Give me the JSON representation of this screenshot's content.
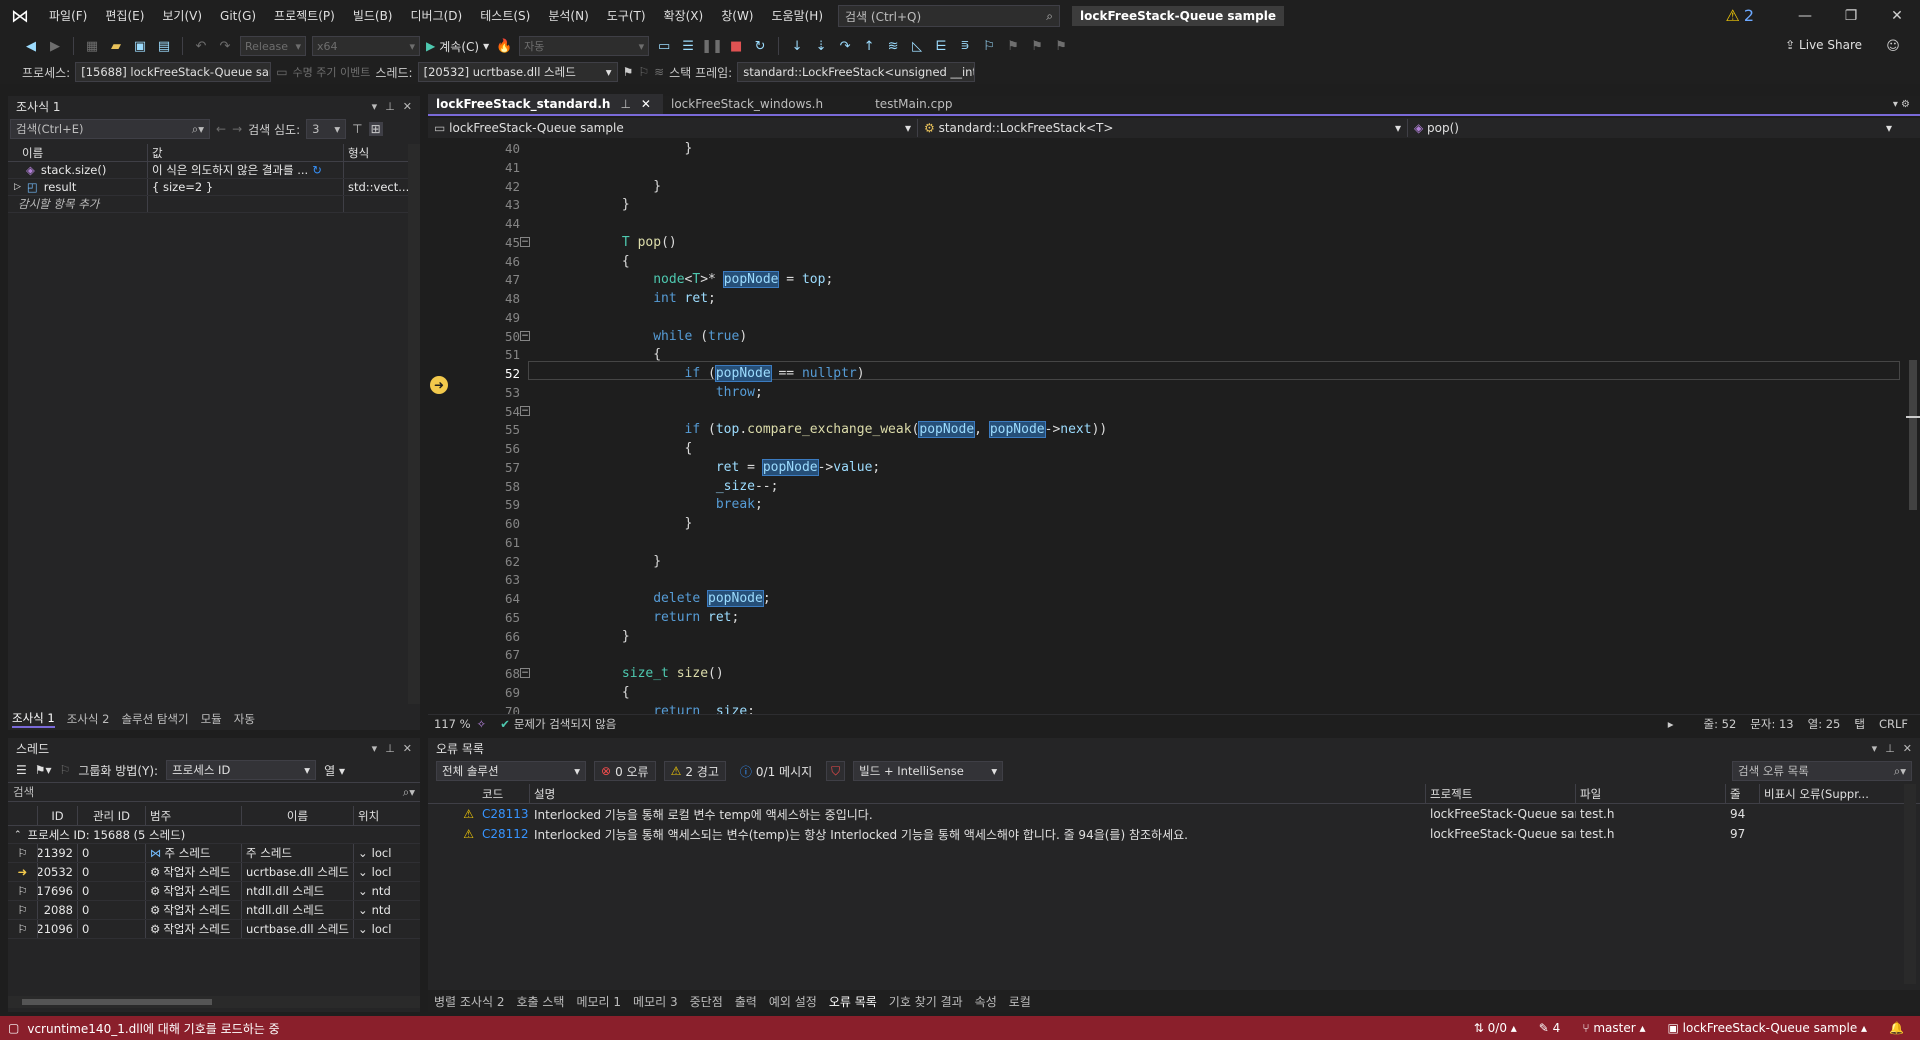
{
  "menu": {
    "items": [
      "파일(F)",
      "편집(E)",
      "보기(V)",
      "Git(G)",
      "프로젝트(P)",
      "빌드(B)",
      "디버그(D)",
      "테스트(S)",
      "분석(N)",
      "도구(T)",
      "확장(X)",
      "창(W)",
      "도움말(H)"
    ],
    "search_placeholder": "검색 (Ctrl+Q)",
    "solution_title": "lockFreeStack-Queue sample",
    "warning_count": "2"
  },
  "toolbar": {
    "config": "Release",
    "platform": "x64",
    "continue_label": "계속(C)",
    "auto_label": "자동",
    "live_share": "Live Share"
  },
  "debugbar": {
    "process_label": "프로세스:",
    "process_value": "[15688] lockFreeStack-Queue sar",
    "lifecycle_label": "수명 주기 이벤트",
    "thread_label": "스레드:",
    "thread_value": "[20532] ucrtbase.dll 스레드",
    "stackframe_label": "스택 프레임:",
    "stackframe_value": "standard::LockFreeStack<unsigned __int6"
  },
  "watch": {
    "title": "조사식 1",
    "search_placeholder": "검색(Ctrl+E)",
    "depth_label": "검색 심도:",
    "depth_value": "3",
    "columns": [
      "이름",
      "값",
      "형식"
    ],
    "rows": [
      {
        "name": "stack.size()",
        "value": "이 식은 의도하지 않은 결과를 ...",
        "type": ""
      },
      {
        "name": "result",
        "value": "{ size=2 }",
        "type": "std::vect..."
      }
    ],
    "add_item": "감시할 항목 추가",
    "tabs": [
      "조사식 1",
      "조사식 2",
      "솔루션 탐색기",
      "모듈",
      "자동"
    ]
  },
  "editor": {
    "tabs": [
      {
        "label": "lockFreeStack_standard.h",
        "active": true
      },
      {
        "label": "lockFreeStack_windows.h",
        "active": false
      },
      {
        "label": "testMain.cpp",
        "active": false
      }
    ],
    "nav_project": "lockFreeStack-Queue sample",
    "nav_scope": "standard::LockFreeStack<T>",
    "nav_member": "pop()",
    "line_numbers": [
      "40",
      "41",
      "42",
      "43",
      "44",
      "45",
      "46",
      "47",
      "48",
      "49",
      "50",
      "51",
      "52",
      "53",
      "54",
      "55",
      "56",
      "57",
      "58",
      "59",
      "60",
      "61",
      "62",
      "63",
      "64",
      "65",
      "66",
      "67",
      "68",
      "69",
      "70"
    ],
    "zoom": "117 %",
    "no_issues": "문제가 검색되지 않음",
    "line": "줄: 52",
    "char": "문자: 13",
    "col": "열: 25",
    "tab": "탭",
    "eol": "CRLF"
  },
  "threads": {
    "title": "스레드",
    "group_label": "그룹화 방법(Y):",
    "group_value": "프로세스 ID",
    "columns_label": "열",
    "search_placeholder": "검색",
    "columns": [
      "ID",
      "관리 ID",
      "범주",
      "이름",
      "위치"
    ],
    "process_group": "프로세스 ID: 15688  (5 스레드)",
    "rows": [
      {
        "id": "21392",
        "managed": "0",
        "category": "주 스레드",
        "name": "주 스레드",
        "loc": "locl"
      },
      {
        "id": "20532",
        "managed": "0",
        "category": "작업자 스레드",
        "name": "ucrtbase.dll 스레드",
        "loc": "locl"
      },
      {
        "id": "17696",
        "managed": "0",
        "category": "작업자 스레드",
        "name": "ntdll.dll 스레드",
        "loc": "ntd"
      },
      {
        "id": "2088",
        "managed": "0",
        "category": "작업자 스레드",
        "name": "ntdll.dll 스레드",
        "loc": "ntd"
      },
      {
        "id": "21096",
        "managed": "0",
        "category": "작업자 스레드",
        "name": "ucrtbase.dll 스레드",
        "loc": "locl"
      }
    ]
  },
  "errors": {
    "title": "오류 목록",
    "scope": "전체 솔루션",
    "error_btn": "0 오류",
    "warning_btn": "2 경고",
    "message_btn": "0/1 메시지",
    "build_filter": "빌드 + IntelliSense",
    "search_placeholder": "검색 오류 목록",
    "columns": [
      "코드",
      "설명",
      "프로젝트",
      "파일",
      "줄",
      "비표시 오류(Suppr..."
    ],
    "rows": [
      {
        "code": "C28113",
        "desc": "Interlocked 기능을 통해 로컬 변수 temp에 액세스하는 중입니다.",
        "project": "lockFreeStack-Queue sam...",
        "file": "test.h",
        "line": "94"
      },
      {
        "code": "C28112",
        "desc": "Interlocked 기능을 통해 액세스되는 변수(temp)는 항상 Interlocked 기능을 통해 액세스해야 합니다. 줄 94을(를) 참조하세요.",
        "project": "lockFreeStack-Queue sam...",
        "file": "test.h",
        "line": "97"
      }
    ]
  },
  "bottom_tabs": [
    "병렬 조사식 2",
    "호출 스택",
    "메모리 1",
    "메모리 3",
    "중단점",
    "출력",
    "예외 설정",
    "오류 목록",
    "기호 찾기 결과",
    "속성",
    "로컬"
  ],
  "status": {
    "message": "vcruntime140_1.dll에 대해 기호를 로드하는 중",
    "sync": "0/0",
    "edits": "4",
    "branch": "master",
    "repo": "lockFreeStack-Queue sample"
  },
  "colors": {
    "statusbar": "#8a1f2b",
    "accent": "#7a6ad8",
    "highlight": "#264f78"
  }
}
